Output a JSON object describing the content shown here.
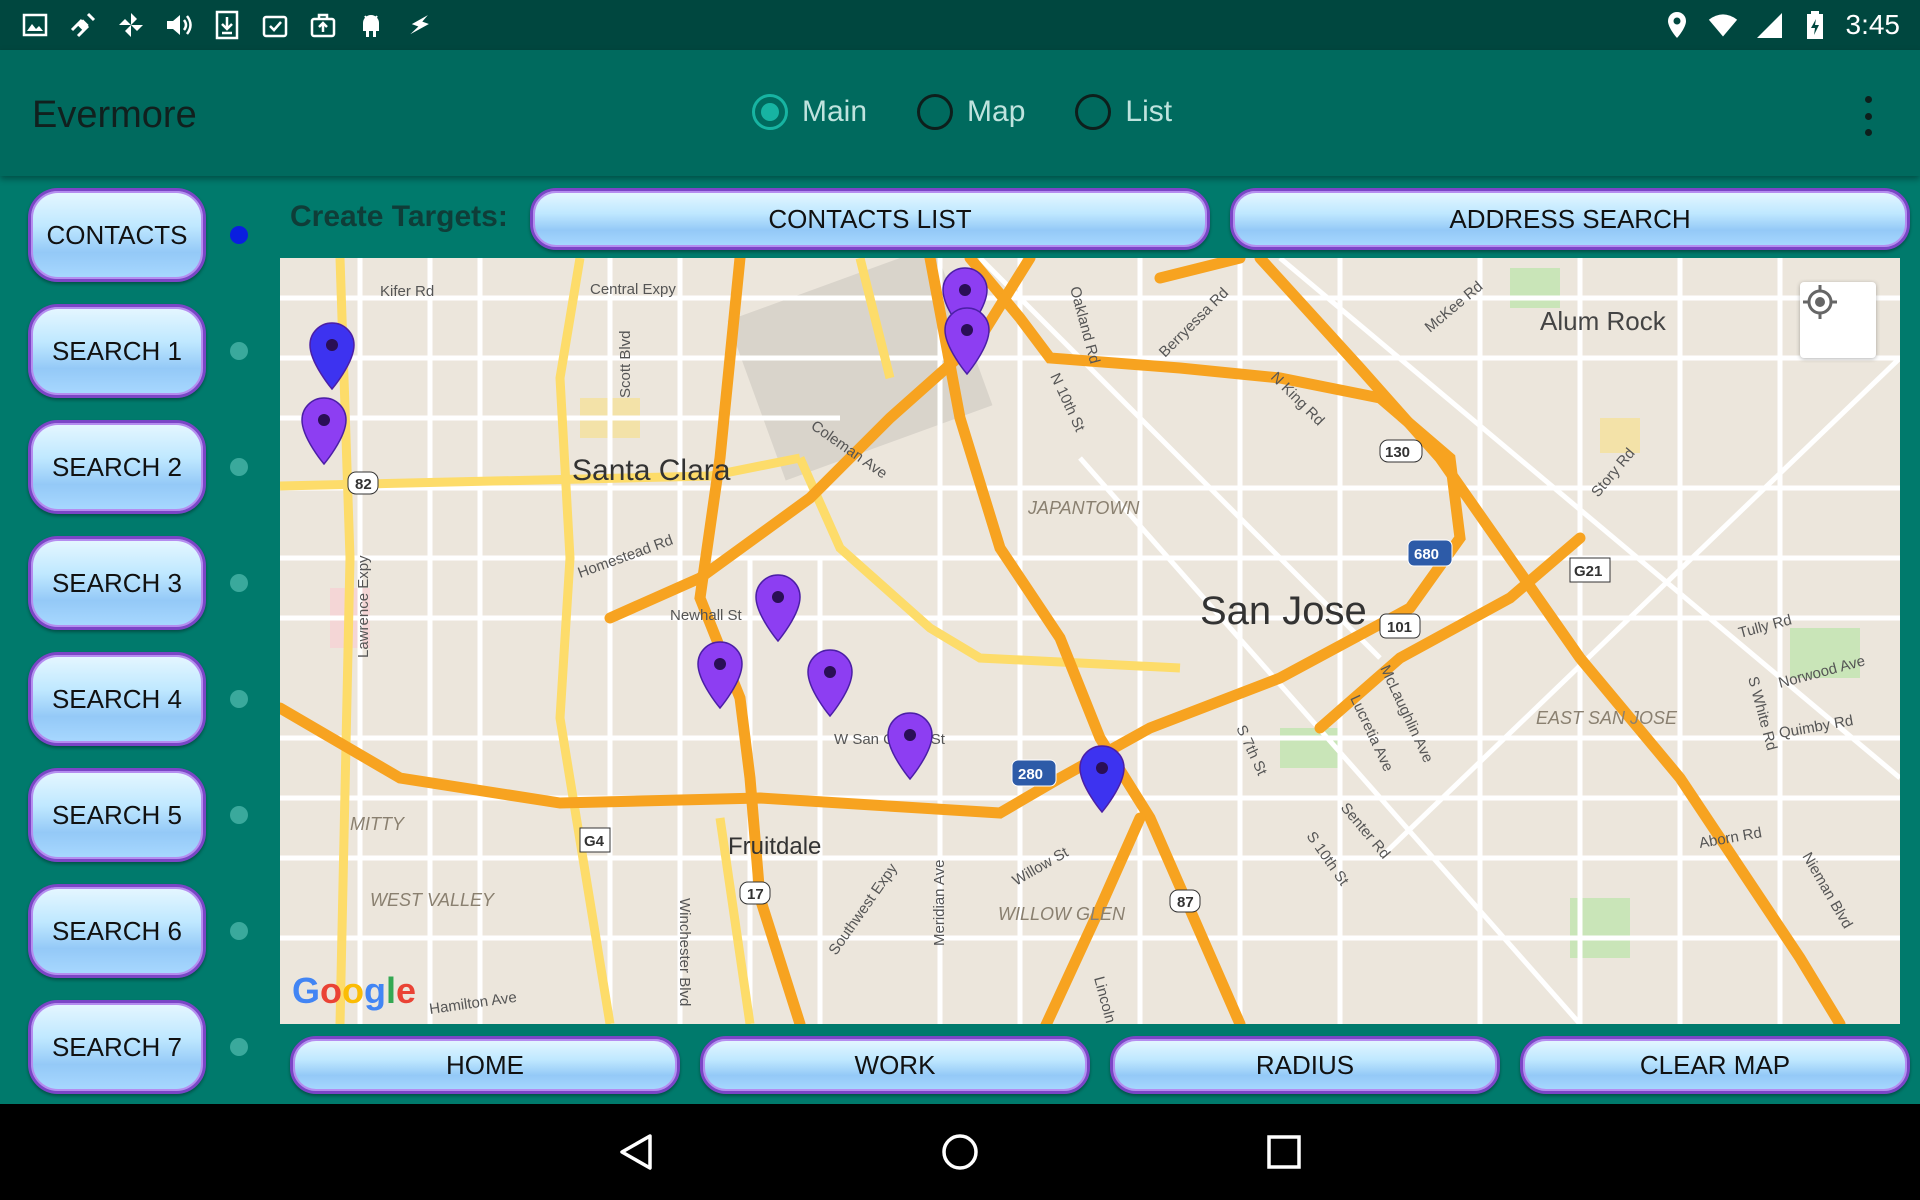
{
  "status_bar": {
    "time": "3:45",
    "left_icons": [
      "image-icon",
      "satellite-icon",
      "pinwheel-icon",
      "volume-icon",
      "download-icon",
      "clipboard-check-icon",
      "briefcase-upload-icon",
      "android-icon",
      "flash-icon"
    ],
    "right_icons": [
      "location-icon",
      "wifi-icon",
      "signal-icon",
      "battery-charging-icon"
    ]
  },
  "app_bar": {
    "title": "Evermore",
    "modes": [
      {
        "label": "Main",
        "checked": true
      },
      {
        "label": "Map",
        "checked": false
      },
      {
        "label": "List",
        "checked": false
      }
    ],
    "overflow_icon": "more-vert-icon"
  },
  "sidebar": {
    "buttons": [
      {
        "label": "CONTACTS",
        "active": true
      },
      {
        "label": "SEARCH 1",
        "active": false
      },
      {
        "label": "SEARCH 2",
        "active": false
      },
      {
        "label": "SEARCH 3",
        "active": false
      },
      {
        "label": "SEARCH 4",
        "active": false
      },
      {
        "label": "SEARCH 5",
        "active": false
      },
      {
        "label": "SEARCH 6",
        "active": false
      },
      {
        "label": "SEARCH 7",
        "active": false
      }
    ]
  },
  "targets": {
    "label": "Create Targets:",
    "contacts_list": "CONTACTS LIST",
    "address_search": "ADDRESS SEARCH"
  },
  "map": {
    "place_labels": {
      "san_jose": "San Jose",
      "santa_clara": "Santa Clara",
      "alum_rock": "Alum Rock",
      "fruitdale": "Fruitdale",
      "japantown": "JAPANTOWN",
      "east_san_jose": "EAST SAN JOSE",
      "willow_glen": "WILLOW GLEN",
      "west_valley": "WEST VALLEY",
      "mitty": "MITTY"
    },
    "street_labels": {
      "kifer": "Kifer Rd",
      "central": "Central Expy",
      "scott": "Scott Blvd",
      "oakland": "Oakland Rd",
      "berryessa": "Berryessa Rd",
      "mckee": "McKee Rd",
      "n10th": "N 10th St",
      "nking": "N King Rd",
      "coleman": "Coleman Ave",
      "homestead": "Homestead Rd",
      "newhall": "Newhall St",
      "lawrence": "Lawrence Expy",
      "story": "Story Rd",
      "tully": "Tully Rd",
      "swhite": "S White Rd",
      "norwood": "Norwood Ave",
      "quimby": "Quimby Rd",
      "mclaughlin": "McLaughlin Ave",
      "lucretia": "Lucretia Ave",
      "s7th": "S 7th St",
      "senter": "Senter Rd",
      "s10th": "S 10th St",
      "wsancarlos": "W San Carlos St",
      "willow": "Willow St",
      "southwest": "Southwest Expy",
      "meridian": "Meridian Ave",
      "winchester": "Winchester Blvd",
      "hamilton": "Hamilton Ave",
      "lincoln": "Lincoln",
      "abornrd": "Aborn Rd",
      "nieman": "Nieman Blvd"
    },
    "shields": {
      "r82": "82",
      "r130": "130",
      "r680": "680",
      "r101": "101",
      "g21": "G21",
      "r280": "280",
      "g4": "G4",
      "r17": "17",
      "r87": "87"
    },
    "logo": "Google",
    "markers": [
      {
        "color": "#8d3ef2"
      },
      {
        "color": "#8d3ef2"
      },
      {
        "color": "#3d33f0"
      },
      {
        "color": "#8d3ef2"
      },
      {
        "color": "#8d3ef2"
      },
      {
        "color": "#8d3ef2"
      },
      {
        "color": "#8d3ef2"
      },
      {
        "color": "#8d3ef2"
      },
      {
        "color": "#3d33f0"
      }
    ]
  },
  "bottom_buttons": {
    "home": "HOME",
    "work": "WORK",
    "radius": "RADIUS",
    "clear_map": "CLEAR MAP"
  },
  "nav_bar": {
    "back": "back-icon",
    "home": "home-circle-icon",
    "recents": "recents-square-icon"
  },
  "colors": {
    "accent": "#17b4a2",
    "app_bar": "#006a5e",
    "background": "#007a6c",
    "status_bar": "#00473f",
    "highway": "#f7a320",
    "active_dot": "#0a1ee0"
  }
}
